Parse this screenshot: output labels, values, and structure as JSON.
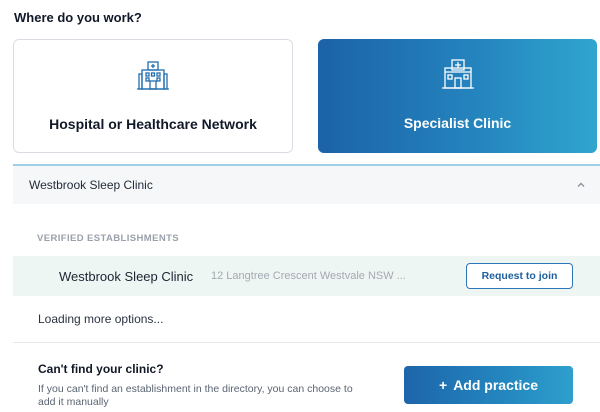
{
  "question": "Where do you work?",
  "workplace_options": [
    {
      "label": "Hospital or Healthcare Network",
      "icon": "hospital-icon",
      "selected": false
    },
    {
      "label": "Specialist Clinic",
      "icon": "clinic-icon",
      "selected": true
    }
  ],
  "clinic_search": {
    "value": "Westbrook Sleep Clinic",
    "expanded": true,
    "icon": "chevron-up-icon"
  },
  "results": {
    "section_label": "VERIFIED ESTABLISHMENTS",
    "items": [
      {
        "name": "Westbrook Sleep Clinic",
        "address": "12 Langtree Crescent Westvale NSW ...",
        "action": "Request to join"
      }
    ],
    "loading_text": "Loading more options..."
  },
  "manual_add": {
    "title": "Can't find your clinic?",
    "description": "If you can't find an establishment in the directory, you can choose to add it manually",
    "button_icon": "+",
    "button_label": "Add practice"
  },
  "colors": {
    "accent_dark": "#1c62a8",
    "accent_light": "#2fa6cf",
    "row_highlight": "#eef6f4",
    "focus_border": "#9fd1e6"
  }
}
